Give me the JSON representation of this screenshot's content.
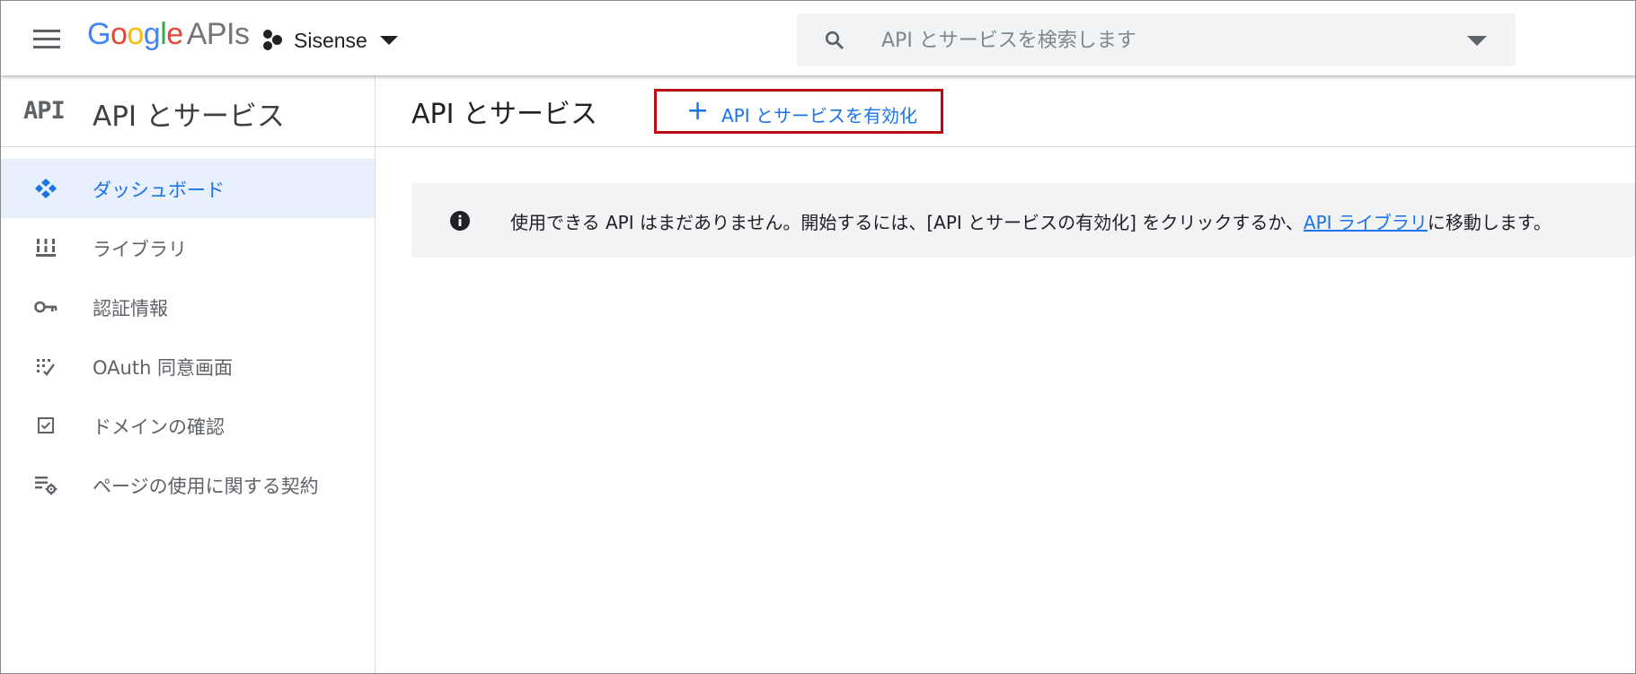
{
  "header": {
    "logo_google": "Google",
    "logo_apis": "APIs",
    "project_name": "Sisense",
    "search_placeholder": "API とサービスを検索します",
    "colors": {
      "google_blue": "#4285F4",
      "google_red": "#EA4335",
      "google_yellow": "#FBBC05",
      "google_green": "#34A853"
    }
  },
  "sidebar": {
    "badge": "API",
    "title": "API とサービス",
    "items": [
      {
        "label": "ダッシュボード",
        "icon": "dashboard-icon",
        "active": true
      },
      {
        "label": "ライブラリ",
        "icon": "library-icon",
        "active": false
      },
      {
        "label": "認証情報",
        "icon": "key-icon",
        "active": false
      },
      {
        "label": "OAuth 同意画面",
        "icon": "consent-icon",
        "active": false
      },
      {
        "label": "ドメインの確認",
        "icon": "checkbox-icon",
        "active": false
      },
      {
        "label": "ページの使用に関する契約",
        "icon": "settings-list-icon",
        "active": false
      }
    ]
  },
  "main": {
    "title": "API とサービス",
    "enable_button": "API とサービスを有効化",
    "info": {
      "text_before": "使用できる API はまだありません。開始するには、[API とサービスの有効化] をクリックするか、",
      "link": "API ライブラリ",
      "text_after": "に移動します。"
    }
  },
  "accent_color": "#1a73e8",
  "highlight_color": "#b80c12"
}
